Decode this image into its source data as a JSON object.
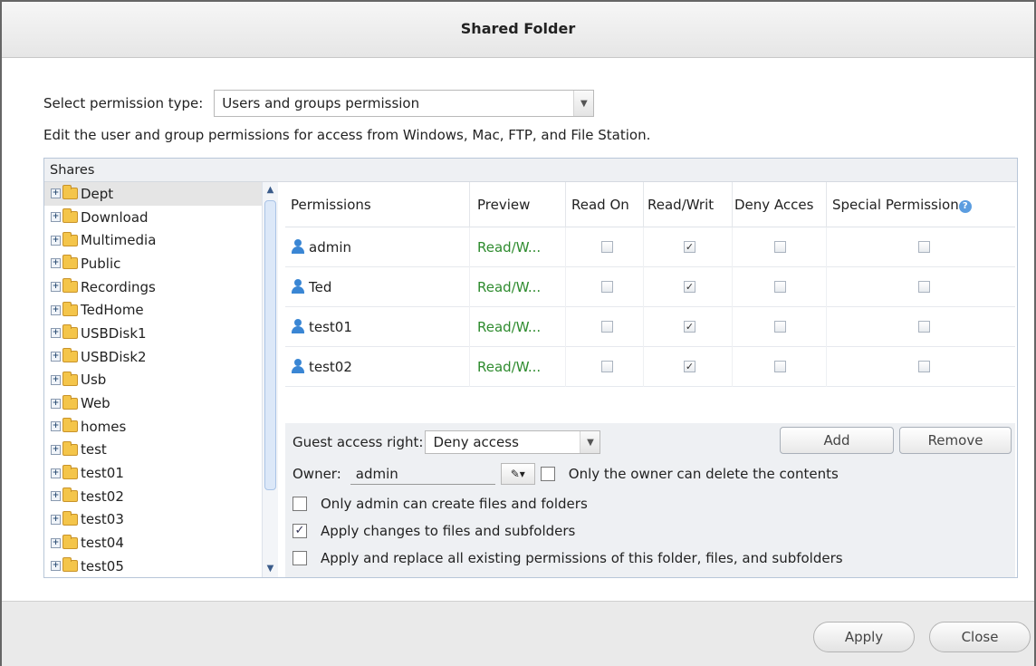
{
  "window": {
    "title": "Shared Folder"
  },
  "permission_type": {
    "label": "Select permission type:",
    "value": "Users and groups permission"
  },
  "description": "Edit the user and group permissions for access from Windows, Mac, FTP, and File Station.",
  "shares": {
    "header": "Shares",
    "items": [
      "Dept",
      "Download",
      "Multimedia",
      "Public",
      "Recordings",
      "TedHome",
      "USBDisk1",
      "USBDisk2",
      "Usb",
      "Web",
      "homes",
      "test",
      "test01",
      "test02",
      "test03",
      "test04",
      "test05"
    ]
  },
  "grid": {
    "columns": [
      "Permissions",
      "Preview",
      "Read On",
      "Read/Writ",
      "Deny Acces",
      "Special Permission"
    ],
    "rows": [
      {
        "name": "admin",
        "preview": "Read/W...",
        "read_only": false,
        "read_write": true,
        "deny": false,
        "special": false
      },
      {
        "name": "Ted",
        "preview": "Read/W...",
        "read_only": false,
        "read_write": true,
        "deny": false,
        "special": false
      },
      {
        "name": "test01",
        "preview": "Read/W...",
        "read_only": false,
        "read_write": true,
        "deny": false,
        "special": false
      },
      {
        "name": "test02",
        "preview": "Read/W...",
        "read_only": false,
        "read_write": true,
        "deny": false,
        "special": false
      }
    ]
  },
  "guest_access": {
    "label": "Guest access right:",
    "value": "Deny access"
  },
  "buttons": {
    "add": "Add",
    "remove": "Remove",
    "apply": "Apply",
    "close": "Close"
  },
  "owner": {
    "label": "Owner:",
    "value": "admin"
  },
  "options": {
    "owner_delete": {
      "label": "Only the owner can delete the contents",
      "checked": false
    },
    "admin_create": {
      "label": "Only admin can create files and folders",
      "checked": false
    },
    "apply_changes": {
      "label": "Apply changes to files and subfolders",
      "checked": true
    },
    "apply_replace": {
      "label": "Apply and replace all existing permissions of this folder, files, and subfolders",
      "checked": false
    }
  }
}
